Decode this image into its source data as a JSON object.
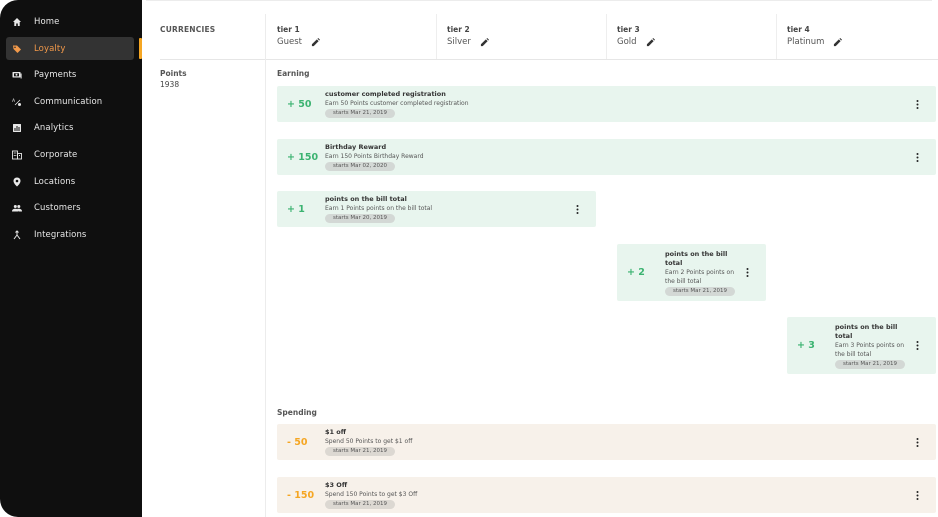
{
  "sidebar": {
    "items": [
      {
        "label": "Home",
        "icon": "home-icon",
        "active": false
      },
      {
        "label": "Loyalty",
        "icon": "tag-icon",
        "active": true
      },
      {
        "label": "Payments",
        "icon": "payments-icon",
        "active": false
      },
      {
        "label": "Communication",
        "icon": "communication-icon",
        "active": false
      },
      {
        "label": "Analytics",
        "icon": "analytics-icon",
        "active": false
      },
      {
        "label": "Corporate",
        "icon": "corporate-icon",
        "active": false
      },
      {
        "label": "Locations",
        "icon": "location-pin-icon",
        "active": false
      },
      {
        "label": "Customers",
        "icon": "customers-icon",
        "active": false
      },
      {
        "label": "Integrations",
        "icon": "integrations-icon",
        "active": false
      }
    ],
    "accent_color": "#f5a623"
  },
  "header": {
    "currencies_label": "CURRENCIES",
    "tiers": [
      {
        "num": "tier 1",
        "name": "Guest"
      },
      {
        "num": "tier 2",
        "name": "Silver"
      },
      {
        "num": "tier 3",
        "name": "Gold"
      },
      {
        "num": "tier 4",
        "name": "Platinum"
      }
    ]
  },
  "currency": {
    "name": "Points",
    "value": "1938"
  },
  "earning": {
    "label": "Earning",
    "cards": [
      {
        "value": "+ 50",
        "title": "customer completed registration",
        "desc": "Earn 50 Points customer completed registration",
        "starts": "starts Mar 21, 2019"
      },
      {
        "value": "+ 150",
        "title": "Birthday Reward",
        "desc": "Earn 150 Points Birthday Reward",
        "starts": "starts Mar 02, 2020"
      },
      {
        "value": "+ 1",
        "title": "points on the bill total",
        "desc": "Earn 1 Points points on the bill total",
        "starts": "starts Mar 20, 2019"
      },
      {
        "value": "+ 2",
        "title": "points on the bill total",
        "desc": "Earn 2 Points points on the bill total",
        "starts": "starts Mar 21, 2019"
      },
      {
        "value": "+ 3",
        "title": "points on the bill total",
        "desc": "Earn 3 Points points on the bill total",
        "starts": "starts Mar 21, 2019"
      }
    ]
  },
  "spending": {
    "label": "Spending",
    "cards": [
      {
        "value": "- 50",
        "title": "$1 off",
        "desc": "Spend 50 Points to get $1 off",
        "starts": "starts Mar 21, 2019"
      },
      {
        "value": "- 150",
        "title": "$3 Off",
        "desc": "Spend 150 Points to get $3 Off",
        "starts": "starts Mar 21, 2019"
      }
    ]
  },
  "colors": {
    "earn_bg": "#e8f5ee",
    "earn_text": "#3cb371",
    "spend_bg": "#f7f1ea",
    "spend_text": "#f5a623"
  }
}
